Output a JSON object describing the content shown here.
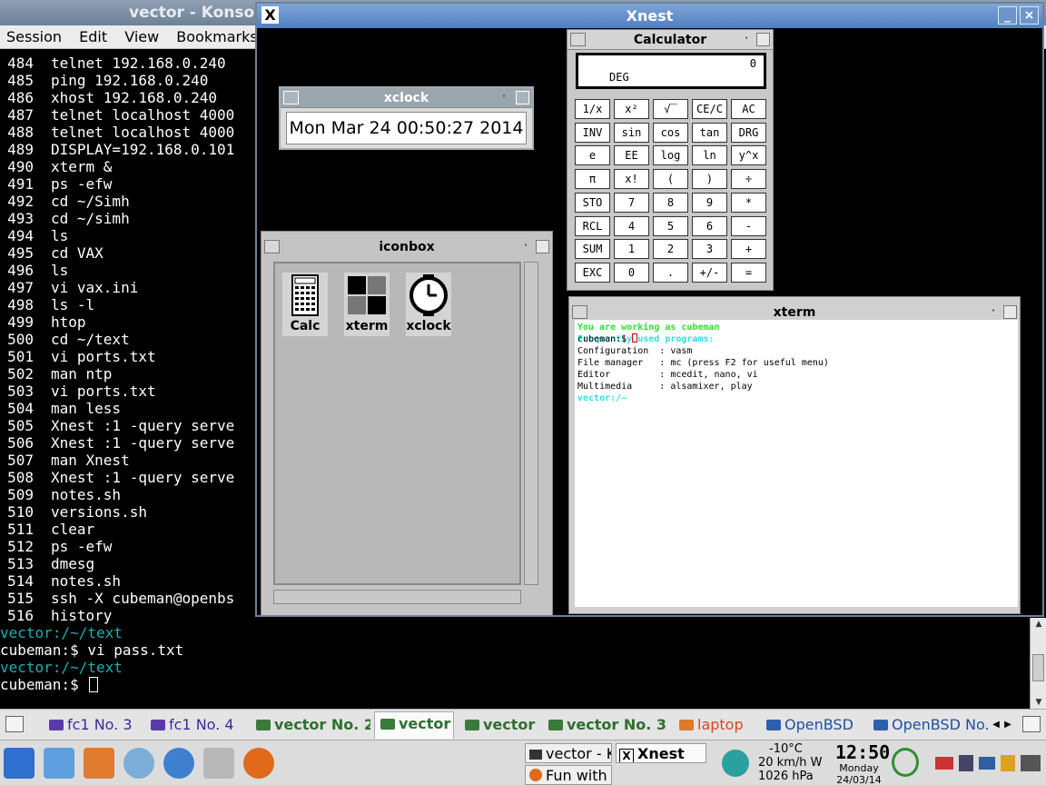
{
  "konsole": {
    "title": "vector - Konsole",
    "menu": [
      "Session",
      "Edit",
      "View",
      "Bookmarks"
    ],
    "history": [
      {
        "n": "484",
        "cmd": "telnet 192.168.0.240"
      },
      {
        "n": "485",
        "cmd": "ping 192.168.0.240"
      },
      {
        "n": "486",
        "cmd": "xhost 192.168.0.240"
      },
      {
        "n": "487",
        "cmd": "telnet localhost 4000"
      },
      {
        "n": "488",
        "cmd": "telnet localhost 4000"
      },
      {
        "n": "489",
        "cmd": "DISPLAY=192.168.0.101"
      },
      {
        "n": "490",
        "cmd": "xterm &"
      },
      {
        "n": "491",
        "cmd": "ps -efw"
      },
      {
        "n": "492",
        "cmd": "cd ~/Simh"
      },
      {
        "n": "493",
        "cmd": "cd ~/simh"
      },
      {
        "n": "494",
        "cmd": "ls"
      },
      {
        "n": "495",
        "cmd": "cd VAX"
      },
      {
        "n": "496",
        "cmd": "ls"
      },
      {
        "n": "497",
        "cmd": "vi vax.ini"
      },
      {
        "n": "498",
        "cmd": "ls -l"
      },
      {
        "n": "499",
        "cmd": "htop"
      },
      {
        "n": "500",
        "cmd": "cd ~/text"
      },
      {
        "n": "501",
        "cmd": "vi ports.txt"
      },
      {
        "n": "502",
        "cmd": "man ntp"
      },
      {
        "n": "503",
        "cmd": "vi ports.txt"
      },
      {
        "n": "504",
        "cmd": "man less"
      },
      {
        "n": "505",
        "cmd": "Xnest :1 -query serve"
      },
      {
        "n": "506",
        "cmd": "Xnest :1 -query serve"
      },
      {
        "n": "507",
        "cmd": "man Xnest"
      },
      {
        "n": "508",
        "cmd": "Xnest :1 -query serve"
      },
      {
        "n": "509",
        "cmd": "notes.sh"
      },
      {
        "n": "510",
        "cmd": "versions.sh"
      },
      {
        "n": "511",
        "cmd": "clear"
      },
      {
        "n": "512",
        "cmd": "ps -efw"
      },
      {
        "n": "513",
        "cmd": "dmesg"
      },
      {
        "n": "514",
        "cmd": "notes.sh"
      },
      {
        "n": "515",
        "cmd": "ssh -X cubeman@openbs"
      },
      {
        "n": "516",
        "cmd": "history"
      }
    ],
    "path1": "vector:/~/text",
    "prompt1": "cubeman:$ vi pass.txt",
    "path2": "vector:/~/text",
    "prompt2": "cubeman:$ "
  },
  "xnest": {
    "title": "Xnest",
    "min_label": "_",
    "close_label": "×",
    "logo": "X"
  },
  "calculator": {
    "title": "Calculator",
    "display_value": "0",
    "mode": "DEG",
    "keys": [
      [
        "1/x",
        "x²",
        "√‾",
        "CE/C",
        "AC"
      ],
      [
        "INV",
        "sin",
        "cos",
        "tan",
        "DRG"
      ],
      [
        "e",
        "EE",
        "log",
        "ln",
        "y^x"
      ],
      [
        "π",
        "x!",
        "(",
        ")",
        "÷"
      ],
      [
        "STO",
        "7",
        "8",
        "9",
        "*"
      ],
      [
        "RCL",
        "4",
        "5",
        "6",
        "-"
      ],
      [
        "SUM",
        "1",
        "2",
        "3",
        "+"
      ],
      [
        "EXC",
        "0",
        ".",
        "+/-",
        "="
      ]
    ]
  },
  "xclock": {
    "title": "xclock",
    "time": "Mon Mar 24 00:50:27 2014"
  },
  "iconbox": {
    "title": "iconbox",
    "icons": [
      {
        "label": "Calc",
        "icon": "calculator-icon"
      },
      {
        "label": "xterm",
        "icon": "xterm-icon"
      },
      {
        "label": "xclock",
        "icon": "clock-icon"
      }
    ]
  },
  "xterm": {
    "title": "xterm",
    "lines": [
      {
        "text": "You are working as cubeman",
        "style": "green"
      },
      {
        "text": "Frequently used programs:",
        "style": "cyan"
      },
      {
        "text": "Configuration  : vasm",
        "style": ""
      },
      {
        "text": "File manager   : mc (press F2 for useful menu)",
        "style": ""
      },
      {
        "text": "Editor         : mcedit, nano, vi",
        "style": ""
      },
      {
        "text": "Multimedia     : alsamixer, play",
        "style": ""
      },
      {
        "text": "vector:/~",
        "style": "cyan"
      }
    ],
    "prompt": "cubeman:$ "
  },
  "taskbar": {
    "tasks": [
      {
        "label": "fc1 No. 3",
        "kind": "purple"
      },
      {
        "label": "fc1 No. 4",
        "kind": "purple"
      },
      {
        "label": "vector No. 2",
        "kind": "green"
      },
      {
        "label": "vector",
        "kind": "green"
      },
      {
        "label": "vector",
        "kind": "green"
      },
      {
        "label": "vector No. 3",
        "kind": "green"
      },
      {
        "label": "laptop",
        "kind": "red"
      },
      {
        "label": "OpenBSD",
        "kind": "blue"
      },
      {
        "label": "OpenBSD No.",
        "kind": "blue"
      }
    ]
  },
  "panel": {
    "task1": "vector - K",
    "task2": "Xnest",
    "task3": "Fun with",
    "weather": {
      "temp": "-10°C",
      "wind": "20 km/h W",
      "pressure": "1026 hPa"
    },
    "clock": {
      "time": "12:50",
      "day": "Monday",
      "date": "24/03/14"
    },
    "colors": {
      "accent": "#4f7fc0",
      "term_cyan": "#18b2b2"
    }
  }
}
